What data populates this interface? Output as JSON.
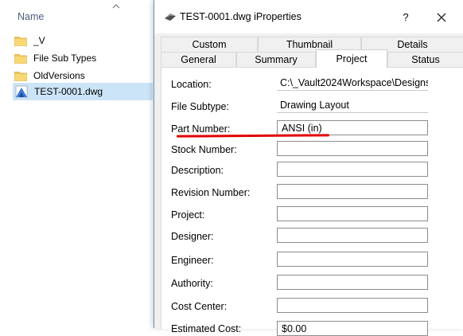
{
  "explorer": {
    "column_header": "Name",
    "files": [
      {
        "name": "_V",
        "icon": "folder-icon"
      },
      {
        "name": "File Sub Types",
        "icon": "folder-icon"
      },
      {
        "name": "OldVersions",
        "icon": "folder-icon"
      },
      {
        "name": "TEST-0001.dwg",
        "icon": "dwg-file-icon",
        "selected": true
      }
    ]
  },
  "dialog": {
    "title": "TEST-0001.dwg iProperties",
    "help_label": "?",
    "tabs_row1": [
      "Custom",
      "Thumbnail",
      "Details"
    ],
    "tabs_row2": [
      "General",
      "Summary",
      "Project",
      "Status"
    ],
    "active_tab": "Project",
    "fields": [
      {
        "label": "Location:",
        "value": "C:\\_Vault2024Workspace\\Designs\\",
        "readonly": true
      },
      {
        "label": "File Subtype:",
        "value": "Drawing Layout",
        "readonly": true
      },
      {
        "label": "Part Number:",
        "value": "ANSI (in)"
      },
      {
        "label": "Stock Number:",
        "value": ""
      },
      {
        "label": "Description:",
        "value": ""
      },
      {
        "label": "Revision Number:",
        "value": ""
      },
      {
        "label": "Project:",
        "value": ""
      },
      {
        "label": "Designer:",
        "value": ""
      },
      {
        "label": "Engineer:",
        "value": ""
      },
      {
        "label": "Authority:",
        "value": ""
      },
      {
        "label": "Cost Center:",
        "value": ""
      },
      {
        "label": "Estimated Cost:",
        "value": "$0.00"
      }
    ]
  },
  "colors": {
    "selection": "#cce4f7",
    "annotation_underline": "#e30000",
    "folder": "#f2c75b"
  }
}
